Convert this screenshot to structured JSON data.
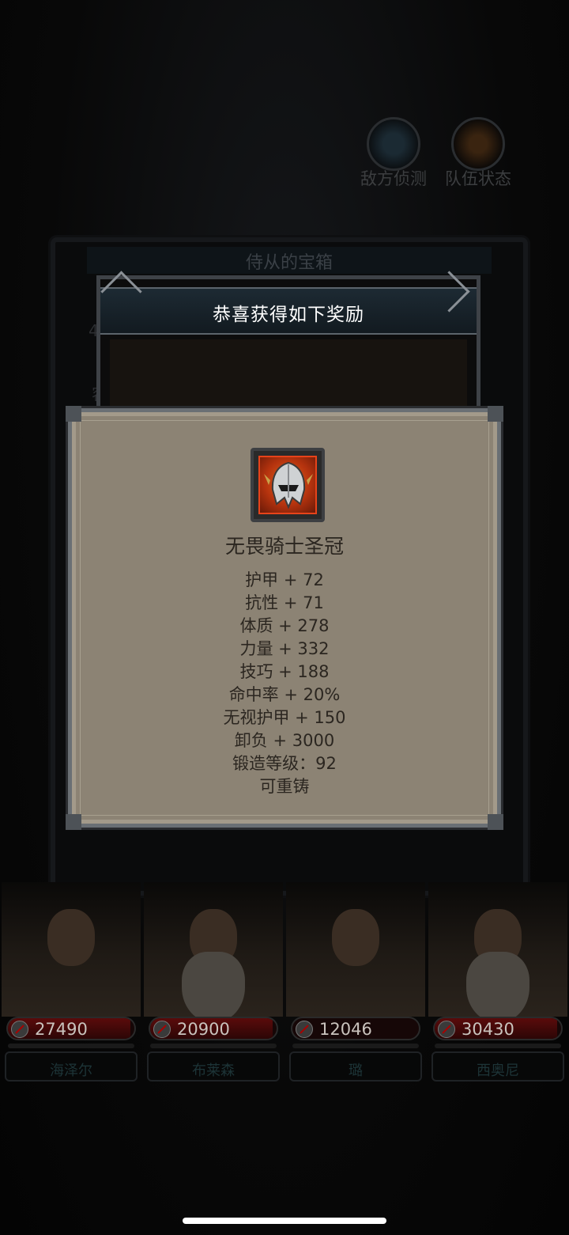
{
  "background": {
    "faded_title": "",
    "enemy_scan_label": "敌方侦测",
    "team_status_label": "队伍状态",
    "chest_title": "侍从的宝箱",
    "side_number": "4",
    "side_char": "容"
  },
  "reward_dialog": {
    "title": "恭喜获得如下奖励"
  },
  "item": {
    "icon": "knight-helmet-icon",
    "name": "无畏骑士圣冠",
    "stats": [
      "护甲 + 72",
      "抗性 + 71",
      "体质 + 278",
      "力量 + 332",
      "技巧 + 188",
      "命中率 + 20%",
      "无视护甲 + 150",
      "卸负 + 3000",
      "锻造等级：92",
      "可重铸"
    ]
  },
  "heroes": [
    {
      "hp": "27490",
      "name": "海泽尔",
      "hp_fraction": 0.97
    },
    {
      "hp": "20900",
      "name": "布莱森",
      "hp_fraction": 0.97
    },
    {
      "hp": "12046",
      "name": "璐",
      "hp_fraction": 0.0
    },
    {
      "hp": "30430",
      "name": "西奥尼",
      "hp_fraction": 0.97
    }
  ],
  "colors": {
    "panel": "#8c8374",
    "hp_red": "#5a0b0b",
    "item_rarity": "#e0661e"
  }
}
